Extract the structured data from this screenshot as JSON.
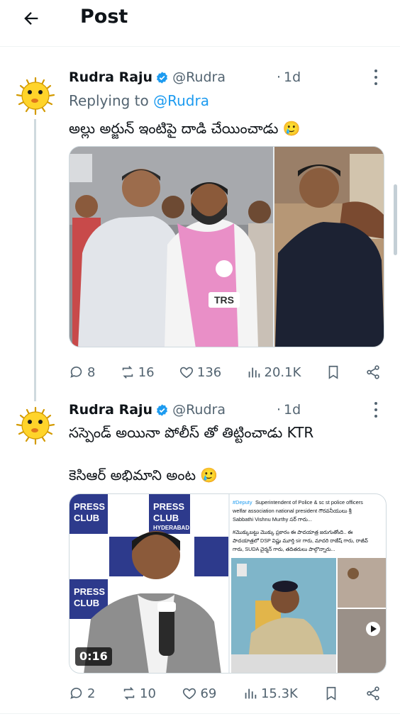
{
  "header": {
    "title": "Post"
  },
  "tweets": [
    {
      "author_name": "Rudra Raju",
      "handle": "@Rudra",
      "dot": "·",
      "time": "1d",
      "replying_prefix": "Replying to",
      "replying_to": "@Rudra",
      "text_lines": [
        "అల్లు అర్జున్ ఇంటిపై దాడి చేయించాడు 🥲"
      ],
      "stats": {
        "replies": "8",
        "reposts": "16",
        "likes": "136",
        "views": "20.1K"
      }
    },
    {
      "author_name": "Rudra Raju",
      "handle": "@Rudra",
      "dot": "·",
      "time": "1d",
      "text_lines": [
        "సస్పెండ్ అయినా పోలీస్ తో తిట్టించాడు KTR",
        "కెసిఆర్ అభిమాని అంట 🥲"
      ],
      "media": {
        "video_duration": "0:16",
        "press_club_label_1": "PRESS",
        "press_club_label_2": "CLUB",
        "press_club_label_3": "HYDERABAD",
        "trs_badge": "TRS",
        "post_text_hashtag": "#Deputy",
        "post_text_line1": "Superintendent of Police & sc st police officers",
        "post_text_line2": "welfar association national president గౌరవనీయులు శ్రీ",
        "post_text_line3": "Sabbathi Vishnu Murthy సర్ గారు...",
        "post_text_line4": "#మొక్కుబట్టు మొక్కు ప్రకారం ఈ పాదయాత్ర జరుగుతోంది.. ఈ",
        "post_text_line5": "పాదయాత్రలో DSP విష్ణు మూర్తి sir గారు, మాదరి రాజేష్ గారు, రాజీవ్",
        "post_text_line6": "గారు, SUDA చైర్మన్ గారు, తదితరులు పాల్గొన్నారు..."
      },
      "stats": {
        "replies": "2",
        "reposts": "10",
        "likes": "69",
        "views": "15.3K"
      }
    }
  ],
  "colors": {
    "text": "#0f1419",
    "secondary": "#536471",
    "accent": "#1d9bf0",
    "verified": "#1d9bf0",
    "border": "#cfd9de"
  },
  "icons": {
    "back": "arrow-left-icon",
    "verified": "verified-badge-icon",
    "more": "more-vertical-icon",
    "reply": "reply-bubble-icon",
    "repost": "repost-icon",
    "like": "heart-icon",
    "views": "views-bar-chart-icon",
    "bookmark": "bookmark-icon",
    "share": "share-icon"
  }
}
